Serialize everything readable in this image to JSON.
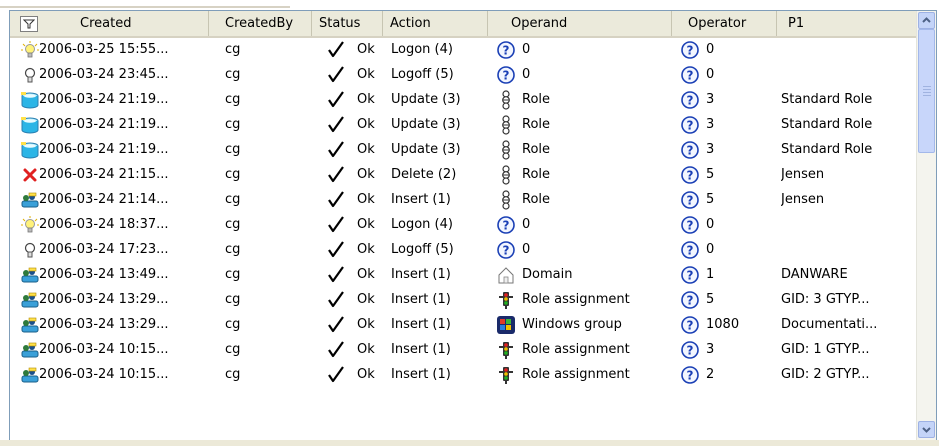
{
  "columns": [
    {
      "key": "created",
      "label": "Created"
    },
    {
      "key": "createdby",
      "label": "CreatedBy"
    },
    {
      "key": "status",
      "label": "Status"
    },
    {
      "key": "action",
      "label": "Action"
    },
    {
      "key": "operand",
      "label": "Operand"
    },
    {
      "key": "operator",
      "label": "Operator"
    },
    {
      "key": "p1",
      "label": "P1"
    }
  ],
  "filter_button": {
    "icon": "filter-funnel-icon"
  },
  "rows": [
    {
      "icon": "bulb-lit-icon",
      "created": "2006-03-25 15:55...",
      "createdby": "cg",
      "status": "Ok",
      "action": "Logon (4)",
      "operand_icon": "question-icon",
      "operand": "0",
      "operator": "0",
      "p1": ""
    },
    {
      "icon": "bulb-off-icon",
      "created": "2006-03-24 23:45...",
      "createdby": "cg",
      "status": "Ok",
      "action": "Logoff (5)",
      "operand_icon": "question-icon",
      "operand": "0",
      "operator": "0",
      "p1": ""
    },
    {
      "icon": "update-icon",
      "created": "2006-03-24 21:19...",
      "createdby": "cg",
      "status": "Ok",
      "action": "Update (3)",
      "operand_icon": "role-icon",
      "operand": "Role",
      "operator": "3",
      "p1": "Standard Role"
    },
    {
      "icon": "update-icon",
      "created": "2006-03-24 21:19...",
      "createdby": "cg",
      "status": "Ok",
      "action": "Update (3)",
      "operand_icon": "role-icon",
      "operand": "Role",
      "operator": "3",
      "p1": "Standard Role"
    },
    {
      "icon": "update-icon",
      "created": "2006-03-24 21:19...",
      "createdby": "cg",
      "status": "Ok",
      "action": "Update (3)",
      "operand_icon": "role-icon",
      "operand": "Role",
      "operator": "3",
      "p1": "Standard Role"
    },
    {
      "icon": "delete-icon",
      "created": "2006-03-24 21:15...",
      "createdby": "cg",
      "status": "Ok",
      "action": "Delete (2)",
      "operand_icon": "role-icon",
      "operand": "Role",
      "operator": "5",
      "p1": "Jensen"
    },
    {
      "icon": "insert-icon",
      "created": "2006-03-24 21:14...",
      "createdby": "cg",
      "status": "Ok",
      "action": "Insert (1)",
      "operand_icon": "role-icon",
      "operand": "Role",
      "operator": "5",
      "p1": "Jensen"
    },
    {
      "icon": "bulb-lit-icon",
      "created": "2006-03-24 18:37...",
      "createdby": "cg",
      "status": "Ok",
      "action": "Logon (4)",
      "operand_icon": "question-icon",
      "operand": "0",
      "operator": "0",
      "p1": ""
    },
    {
      "icon": "bulb-off-icon",
      "created": "2006-03-24 17:23...",
      "createdby": "cg",
      "status": "Ok",
      "action": "Logoff (5)",
      "operand_icon": "question-icon",
      "operand": "0",
      "operator": "0",
      "p1": ""
    },
    {
      "icon": "insert-icon",
      "created": "2006-03-24 13:49...",
      "createdby": "cg",
      "status": "Ok",
      "action": "Insert (1)",
      "operand_icon": "domain-icon",
      "operand": "Domain",
      "operator": "1",
      "p1": "DANWARE"
    },
    {
      "icon": "insert-icon",
      "created": "2006-03-24 13:29...",
      "createdby": "cg",
      "status": "Ok",
      "action": "Insert (1)",
      "operand_icon": "role-assignment-icon",
      "operand": "Role assignment",
      "operator": "5",
      "p1": "GID: 3 GTYP..."
    },
    {
      "icon": "insert-icon",
      "created": "2006-03-24 13:29...",
      "createdby": "cg",
      "status": "Ok",
      "action": "Insert (1)",
      "operand_icon": "windows-group-icon",
      "operand": "Windows group",
      "operator": "1080",
      "p1": "Documentati..."
    },
    {
      "icon": "insert-icon",
      "created": "2006-03-24 10:15...",
      "createdby": "cg",
      "status": "Ok",
      "action": "Insert (1)",
      "operand_icon": "role-assignment-icon",
      "operand": "Role assignment",
      "operator": "3",
      "p1": "GID: 1 GTYP..."
    },
    {
      "icon": "insert-icon",
      "created": "2006-03-24 10:15...",
      "createdby": "cg",
      "status": "Ok",
      "action": "Insert (1)",
      "operand_icon": "role-assignment-icon",
      "operand": "Role assignment",
      "operator": "2",
      "p1": "GID: 2 GTYP..."
    }
  ],
  "scrollbar": {
    "up_icon": "scroll-up-icon",
    "down_icon": "scroll-down-icon"
  }
}
